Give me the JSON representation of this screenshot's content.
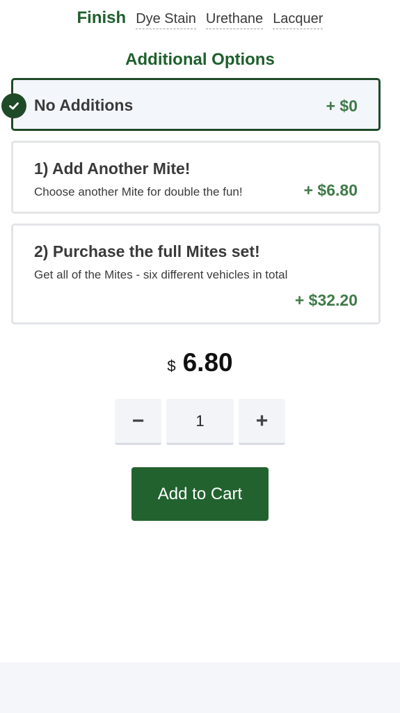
{
  "finish": {
    "label": "Finish",
    "options": [
      "Dye Stain",
      "Urethane",
      "Lacquer"
    ]
  },
  "additional_options": {
    "title": "Additional Options",
    "items": [
      {
        "title": "No Additions",
        "description": "",
        "price": "+ $0",
        "selected": true
      },
      {
        "title": "1) Add Another Mite!",
        "description": "Choose another Mite for double the fun!",
        "price": "+ $6.80",
        "selected": false
      },
      {
        "title": "2) Purchase the full Mites set!",
        "description": "Get all of the Mites - six different vehicles in total",
        "price": "+ $32.20",
        "selected": false
      }
    ]
  },
  "price": {
    "currency": "$",
    "amount": "6.80"
  },
  "quantity": {
    "minus": "−",
    "value": "1",
    "plus": "+"
  },
  "cart": {
    "label": "Add to Cart"
  },
  "colors": {
    "brand_green": "#1f5f2c",
    "price_green": "#3f7a48",
    "selected_border": "#1f4a28",
    "button_green": "#22622f"
  },
  "icons": {
    "selected_check": "check-icon"
  }
}
